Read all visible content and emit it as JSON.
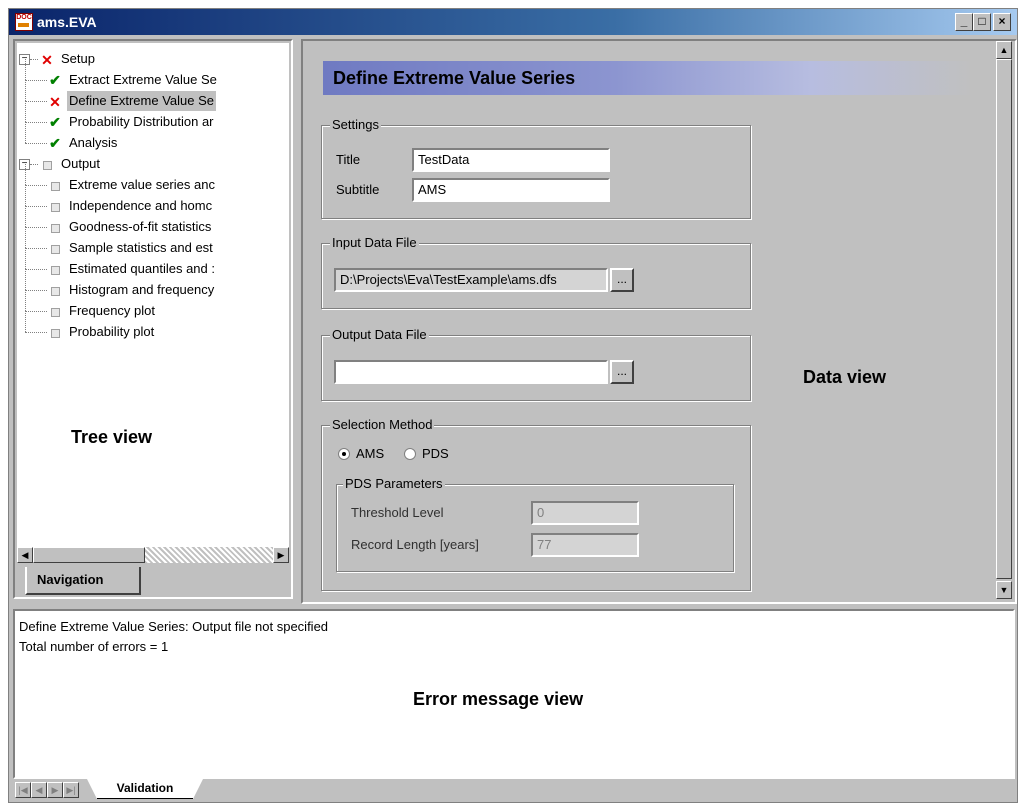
{
  "window": {
    "title": "ams.EVA",
    "app_icon": "doc-icon"
  },
  "window_buttons": {
    "minimize": "_",
    "maximize": "□",
    "close": "×"
  },
  "tree": {
    "items": [
      {
        "label": "Setup",
        "status": "error",
        "level": 0,
        "expanded": true
      },
      {
        "label": "Extract Extreme Value Se",
        "status": "ok",
        "level": 1
      },
      {
        "label": "Define Extreme Value Se",
        "status": "error",
        "level": 1,
        "selected": true
      },
      {
        "label": "Probability Distribution ar",
        "status": "ok",
        "level": 1
      },
      {
        "label": "Analysis",
        "status": "ok",
        "level": 1
      },
      {
        "label": "Output",
        "status": "none",
        "level": 0,
        "expanded": true
      },
      {
        "label": "Extreme value series anc",
        "status": "none",
        "level": 1
      },
      {
        "label": "Independence and homc",
        "status": "none",
        "level": 1
      },
      {
        "label": "Goodness-of-fit statistics",
        "status": "none",
        "level": 1
      },
      {
        "label": "Sample statistics and est",
        "status": "none",
        "level": 1
      },
      {
        "label": "Estimated quantiles and :",
        "status": "none",
        "level": 1
      },
      {
        "label": "Histogram and frequency",
        "status": "none",
        "level": 1
      },
      {
        "label": "Frequency plot",
        "status": "none",
        "level": 1
      },
      {
        "label": "Probability plot",
        "status": "none",
        "level": 1
      }
    ],
    "overlay_label": "Tree view",
    "nav_tab": "Navigation"
  },
  "data_view": {
    "header_title": "Define Extreme Value Series",
    "settings": {
      "legend": "Settings",
      "title_label": "Title",
      "title_value": "TestData",
      "subtitle_label": "Subtitle",
      "subtitle_value": "AMS"
    },
    "input_file": {
      "legend": "Input Data File",
      "value": "D:\\Projects\\Eva\\TestExample\\ams.dfs",
      "browse_label": "..."
    },
    "output_file": {
      "legend": "Output Data File",
      "value": "",
      "browse_label": "..."
    },
    "selection_method": {
      "legend": "Selection Method",
      "options": [
        "AMS",
        "PDS"
      ],
      "selected": "AMS",
      "pds_params": {
        "legend": "PDS Parameters",
        "threshold_label": "Threshold Level",
        "threshold_value": "0",
        "record_label": "Record Length [years]",
        "record_value": "77"
      }
    },
    "overlay_label": "Data view"
  },
  "error_view": {
    "lines": [
      "Define Extreme Value Series: Output file not specified",
      "Total number of errors = 1"
    ],
    "overlay_label": "Error message view",
    "tab": "Validation"
  },
  "colors": {
    "titlebar_start": "#0a246a",
    "titlebar_end": "#a6caf0",
    "header_bar": "#7b86c9",
    "error_mark": "#e00000",
    "ok_mark": "#008000",
    "face": "#c0c0c0"
  }
}
